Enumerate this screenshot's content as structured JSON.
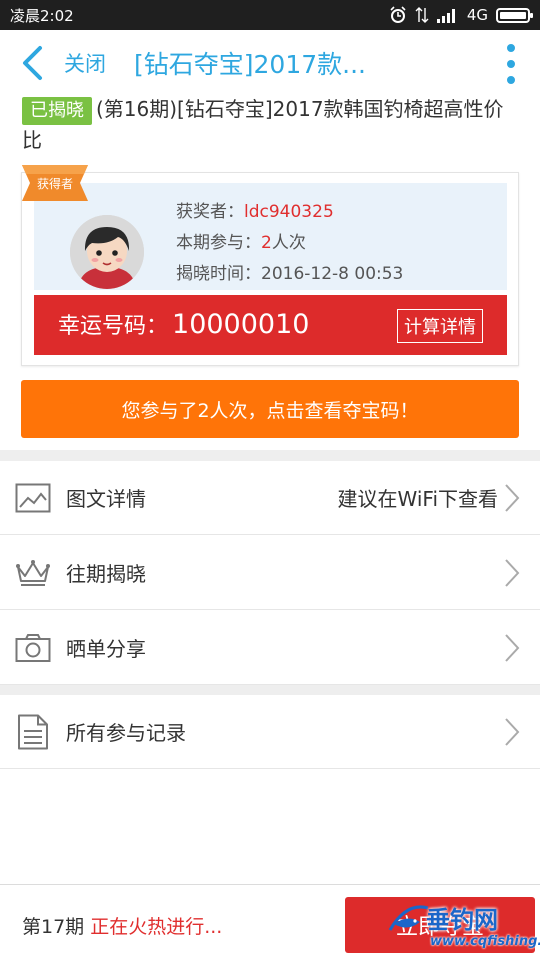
{
  "status_bar": {
    "time": "凌晨2:02",
    "network": "4G"
  },
  "header": {
    "close_label": "关闭",
    "title": "[钻石夺宝]2017款..."
  },
  "product": {
    "badge": "已揭晓",
    "title": "(第16期)[钻石夺宝]2017款韩国钓椅超高性价比"
  },
  "winner": {
    "ribbon_label": "获得者",
    "winner_label": "获奖者：",
    "winner_name": "ldc940325",
    "participation_label": "本期参与：",
    "participation_count": "2",
    "participation_unit": "人次",
    "time_label": "揭晓时间：",
    "time_value": "2016-12-8 00:53",
    "lucky_label": "幸运号码：",
    "lucky_number": "10000010",
    "calc_button": "计算详情"
  },
  "participate_button": "您参与了2人次，点击查看夺宝码！",
  "menu": {
    "details": {
      "label": "图文详情",
      "hint": "建议在WiFi下查看",
      "icon": "image-icon"
    },
    "past": {
      "label": "往期揭晓",
      "icon": "crown-icon"
    },
    "share": {
      "label": "晒单分享",
      "icon": "camera-icon"
    },
    "records": {
      "label": "所有参与记录",
      "icon": "document-icon"
    }
  },
  "bottom": {
    "period": "第17期",
    "status": "正在火热进行...",
    "buy_button": "立即夺宝"
  },
  "watermark": {
    "text": "垂钓网",
    "url": "www.cqfishing.net"
  },
  "colors": {
    "accent_blue": "#2ea7e0",
    "red": "#dd2b2b",
    "orange": "#ff7408",
    "badge_green": "#7ac143"
  }
}
